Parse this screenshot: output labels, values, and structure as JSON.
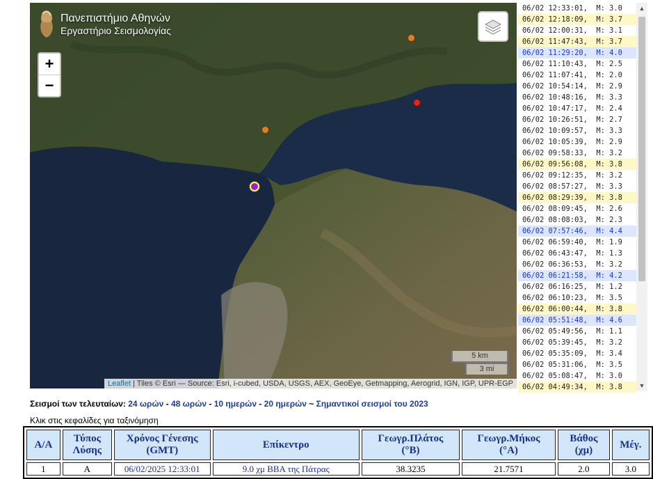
{
  "map": {
    "brand_line1": "Πανεπιστήμιο Αθηνών",
    "brand_line2": "Εργαστήριο Σεισμολογίας",
    "zoom_in": "+",
    "zoom_out": "−",
    "scale_km": "5 km",
    "scale_mi": "3 mi",
    "attribution_link": "Leaflet",
    "attribution_text": " | Tiles © Esri — Source: Esri, i-cubed, USDA, USGS, AEX, GeoEye, Getmapping, Aerogrid, IGN, IGP, UPR-EGP",
    "marker_colors": {
      "orange": "#d9822b",
      "red": "#e0281e",
      "purple": "#a020c8",
      "highlight": "#ffff66"
    }
  },
  "quake_list": [
    {
      "text": "06/02 12:33:01,  M: 3.0",
      "level": "normal"
    },
    {
      "text": "06/02 12:18:09,  M: 3.7",
      "level": "med"
    },
    {
      "text": "06/02 12:00:31,  M: 3.1",
      "level": "normal"
    },
    {
      "text": "06/02 11:47:43,  M: 3.7",
      "level": "med"
    },
    {
      "text": "06/02 11:29:20,  M: 4.0",
      "level": "high"
    },
    {
      "text": "06/02 11:10:43,  M: 2.5",
      "level": "normal"
    },
    {
      "text": "06/02 11:07:41,  M: 2.0",
      "level": "normal"
    },
    {
      "text": "06/02 10:54:14,  M: 2.9",
      "level": "normal"
    },
    {
      "text": "06/02 10:48:16,  M: 3.3",
      "level": "normal"
    },
    {
      "text": "06/02 10:47:17,  M: 2.4",
      "level": "normal"
    },
    {
      "text": "06/02 10:26:51,  M: 2.7",
      "level": "normal"
    },
    {
      "text": "06/02 10:09:57,  M: 3.3",
      "level": "normal"
    },
    {
      "text": "06/02 10:05:39,  M: 2.9",
      "level": "normal"
    },
    {
      "text": "06/02 09:58:33,  M: 3.2",
      "level": "normal"
    },
    {
      "text": "06/02 09:56:08,  M: 3.8",
      "level": "med"
    },
    {
      "text": "06/02 09:12:35,  M: 3.2",
      "level": "normal"
    },
    {
      "text": "06/02 08:57:27,  M: 3.3",
      "level": "normal"
    },
    {
      "text": "06/02 08:29:39,  M: 3.8",
      "level": "med"
    },
    {
      "text": "06/02 08:09:45,  M: 2.6",
      "level": "normal"
    },
    {
      "text": "06/02 08:08:03,  M: 2.3",
      "level": "normal"
    },
    {
      "text": "06/02 07:57:46,  M: 4.4",
      "level": "high"
    },
    {
      "text": "06/02 06:59:40,  M: 1.9",
      "level": "normal"
    },
    {
      "text": "06/02 06:43:47,  M: 1.3",
      "level": "normal"
    },
    {
      "text": "06/02 06:36:53,  M: 3.2",
      "level": "normal"
    },
    {
      "text": "06/02 06:21:58,  M: 4.2",
      "level": "high"
    },
    {
      "text": "06/02 06:16:25,  M: 1.2",
      "level": "normal"
    },
    {
      "text": "06/02 06:10:23,  M: 3.5",
      "level": "normal"
    },
    {
      "text": "06/02 06:00:44,  M: 3.8",
      "level": "med"
    },
    {
      "text": "06/02 05:51:48,  M: 4.6",
      "level": "high"
    },
    {
      "text": "06/02 05:49:56,  M: 1.1",
      "level": "normal"
    },
    {
      "text": "06/02 05:39:45,  M: 3.2",
      "level": "normal"
    },
    {
      "text": "06/02 05:35:09,  M: 3.4",
      "level": "normal"
    },
    {
      "text": "06/02 05:31:06,  M: 3.5",
      "level": "normal"
    },
    {
      "text": "06/02 05:08:47,  M: 3.0",
      "level": "normal"
    },
    {
      "text": "06/02 04:49:34,  M: 3.8",
      "level": "med"
    }
  ],
  "periods": {
    "prefix": "Σεισμοί των τελευταίων: ",
    "h24": "24 ωρών",
    "sep1": " - ",
    "h48": "48 ωρών",
    "sep2": " - ",
    "d10": "10 ημερών",
    "sep3": " - ",
    "d20": "20 ημερών",
    "sep4": " ~ ",
    "major": "Σημαντικοί σεισμοί του 2023"
  },
  "sort_note": "Κλικ στις κεφαλίδες για ταξινόμηση",
  "table": {
    "headers": [
      [
        "Α/Α",
        ""
      ],
      [
        "Τύπος",
        "Λύσης"
      ],
      [
        "Χρόνος Γένεσης",
        "(GMT)"
      ],
      [
        "Επίκεντρο",
        ""
      ],
      [
        "Γεωγρ.Πλάτος",
        "(°Β)"
      ],
      [
        "Γεωγρ.Μήκος",
        "(°Α)"
      ],
      [
        "Βάθος",
        "(χμ)"
      ],
      [
        "Μέγ.",
        ""
      ]
    ],
    "rows": [
      [
        "1",
        "A",
        "06/02/2025 12:33:01",
        "9.0 χμ ΒΒΑ της Πάτρας",
        "38.3235",
        "21.7571",
        "2.0",
        "3.0"
      ]
    ]
  }
}
